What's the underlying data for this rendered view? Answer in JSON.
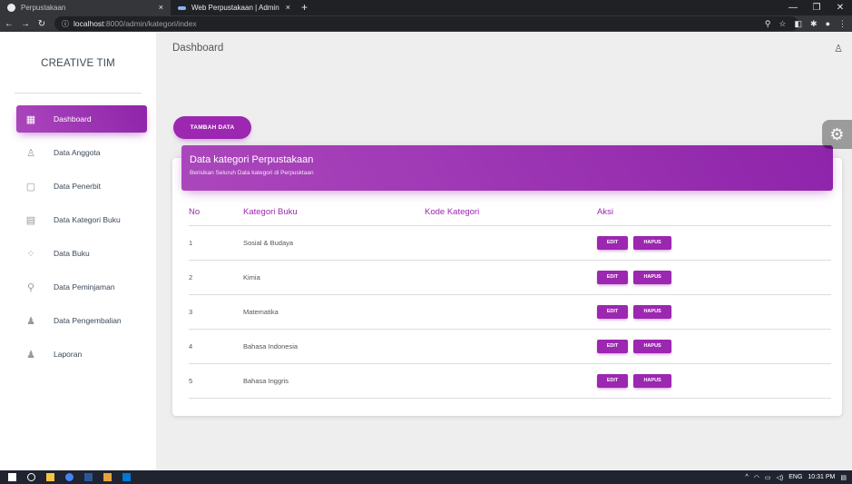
{
  "browser": {
    "tabs": [
      {
        "title": "Perpustakaan"
      },
      {
        "title": "Web Perpustakaan | Admin"
      }
    ],
    "url_host": "localhost",
    "url_rest": ":8000/admin/kategori/index",
    "new_tab": "+",
    "close": "×"
  },
  "sidebar": {
    "brand": "CREATIVE TIM",
    "items": [
      {
        "label": "Dashboard",
        "icon": "dashboard-icon",
        "active": true
      },
      {
        "label": "Data Anggota",
        "icon": "person-icon"
      },
      {
        "label": "Data Penerbit",
        "icon": "content-paste-icon"
      },
      {
        "label": "Data Kategori Buku",
        "icon": "library-books-icon"
      },
      {
        "label": "Data Buku",
        "icon": "bubble-chart-icon"
      },
      {
        "label": "Data Peminjaman",
        "icon": "location-icon"
      },
      {
        "label": "Data Pengembalian",
        "icon": "notifications-icon"
      },
      {
        "label": "Laporan",
        "icon": "notifications-icon"
      }
    ]
  },
  "header": {
    "title": "Dashboard"
  },
  "main": {
    "add_button": "TAMBAH DATA",
    "card": {
      "title": "Data kategori Perpustakaan",
      "subtitle": "Berisikan Seluruh Data kategori di Perpusktaan"
    },
    "table": {
      "headers": [
        "No",
        "Kategori Buku",
        "Kode Kategori",
        "Aksi"
      ],
      "rows": [
        {
          "no": "1",
          "kategori": "Sosial & Budaya",
          "kode": ""
        },
        {
          "no": "2",
          "kategori": "Kimia",
          "kode": ""
        },
        {
          "no": "3",
          "kategori": "Matematika",
          "kode": ""
        },
        {
          "no": "4",
          "kategori": "Bahasa Indonesia",
          "kode": ""
        },
        {
          "no": "5",
          "kategori": "Bahasa Inggris",
          "kode": ""
        }
      ],
      "edit_label": "EDIT",
      "delete_label": "HAPUS"
    }
  },
  "taskbar": {
    "lang": "ENG",
    "time": "10:31 PM"
  },
  "colors": {
    "accent": "#9c27b0",
    "sidebar_bg": "#ffffff",
    "page_bg": "#eeeeee"
  }
}
